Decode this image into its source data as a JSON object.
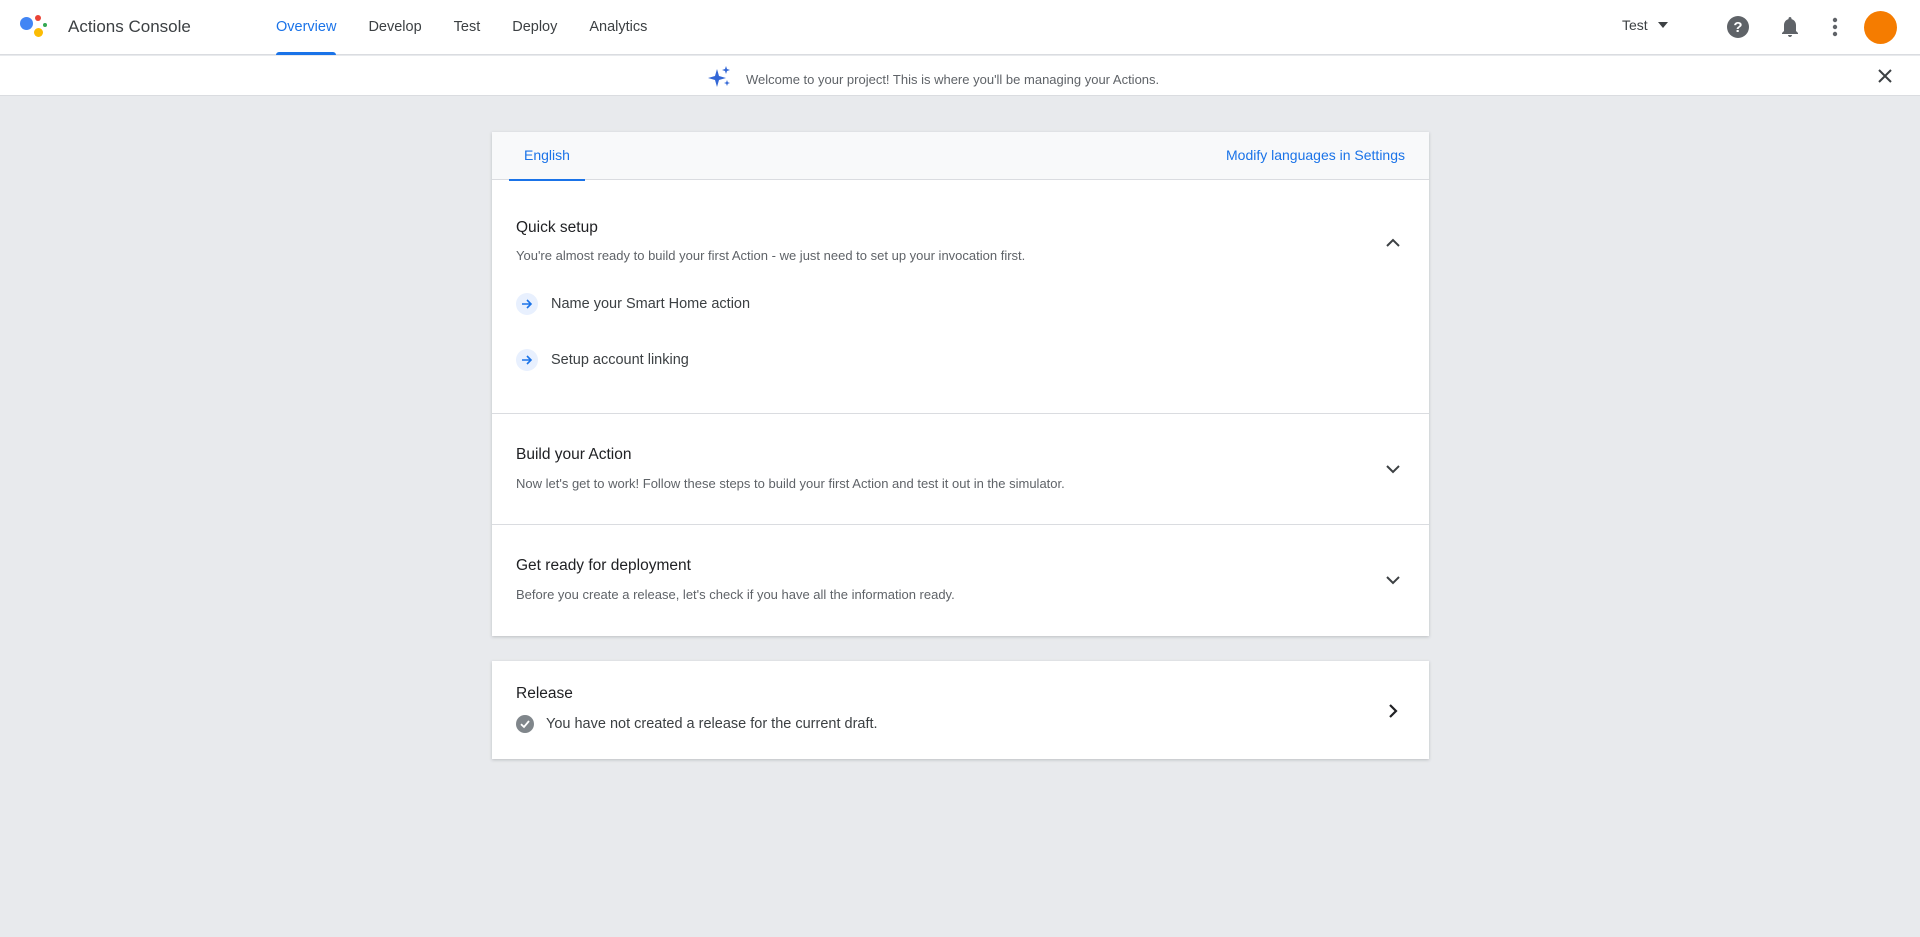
{
  "app": {
    "title": "Actions Console"
  },
  "nav": {
    "tabs": [
      {
        "label": "Overview",
        "active": true
      },
      {
        "label": "Develop",
        "active": false
      },
      {
        "label": "Test",
        "active": false
      },
      {
        "label": "Deploy",
        "active": false
      },
      {
        "label": "Analytics",
        "active": false
      }
    ]
  },
  "header": {
    "project_name": "Test",
    "icons": [
      "help-icon",
      "notifications-icon",
      "more-vert-icon"
    ],
    "avatar_color": "#f57c00"
  },
  "banner": {
    "text": "Welcome to your project! This is where you'll be managing your Actions.",
    "icon": "sparkle-icon"
  },
  "languages": {
    "active": "English",
    "modify_link": "Modify languages in Settings"
  },
  "sections": {
    "quick_setup": {
      "title": "Quick setup",
      "description": "You're almost ready to build your first Action - we just need to set up your invocation first.",
      "expanded": true,
      "steps": [
        {
          "label": "Name your Smart Home action"
        },
        {
          "label": "Setup account linking"
        }
      ]
    },
    "build": {
      "title": "Build your Action",
      "description": "Now let's get to work! Follow these steps to build your first Action and test it out in the simulator.",
      "expanded": false
    },
    "deploy": {
      "title": "Get ready for deployment",
      "description": "Before you create a release, let's check if you have all the information ready.",
      "expanded": false
    }
  },
  "release": {
    "title": "Release",
    "status": "You have not created a release for the current draft."
  },
  "colors": {
    "accent": "#1a73e8",
    "background": "#e8eaed"
  }
}
